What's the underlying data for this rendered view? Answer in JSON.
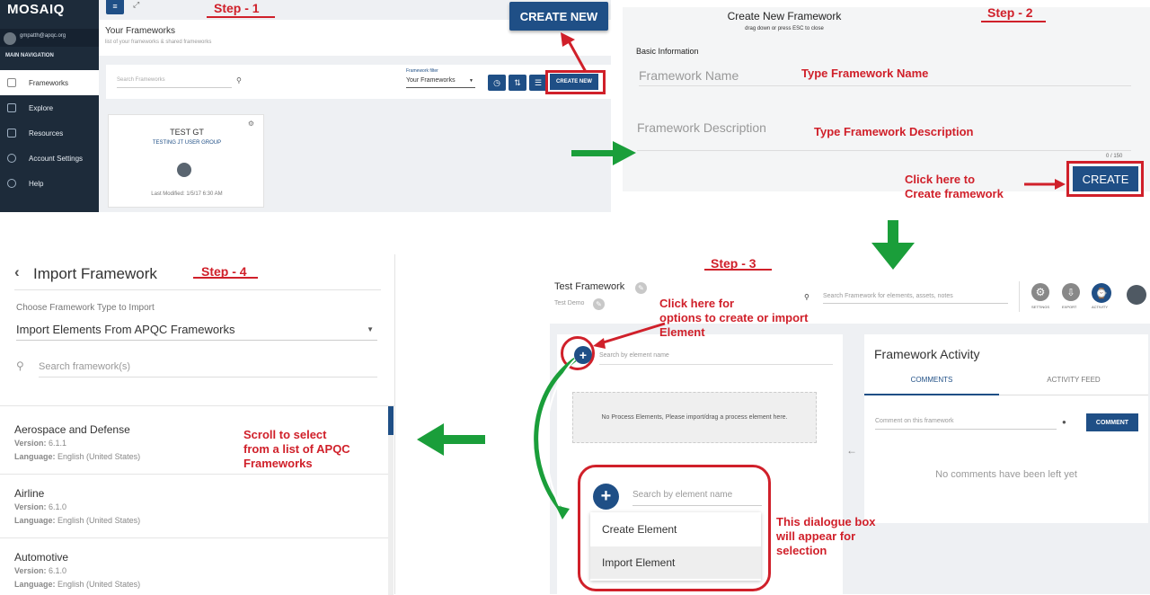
{
  "steps": {
    "step1": "Step - 1",
    "step2": "Step - 2",
    "step3": "Step - 3",
    "step4": "Step - 4"
  },
  "annotations": {
    "type_name": "Type Framework Name",
    "type_desc": "Type Framework Description",
    "click_create_1": "Click here to",
    "click_create_2": "Create framework",
    "click_options_1": "Click here for",
    "click_options_2": "options to create or import",
    "click_options_3": "Element",
    "scroll_1": "Scroll to select",
    "scroll_2": "from a list of APQC",
    "scroll_3": "Frameworks",
    "dialogue_1": "This dialogue box",
    "dialogue_2": "will appear for",
    "dialogue_3": "selection"
  },
  "panel1": {
    "logo": "MOSAIQ",
    "user_email": "gmpatth@apqc.org",
    "main_nav": "MAIN NAVIGATION",
    "nav": [
      {
        "label": "Frameworks"
      },
      {
        "label": "Explore"
      },
      {
        "label": "Resources"
      },
      {
        "label": "Account Settings"
      },
      {
        "label": "Help"
      }
    ],
    "page_title": "Your Frameworks",
    "page_subtitle": "list of your frameworks & shared frameworks",
    "search_placeholder": "Search Frameworks",
    "filter_label": "Framework filter",
    "filter_value": "Your Frameworks",
    "create_new_small": "CREATE NEW",
    "create_new_big": "CREATE NEW",
    "card": {
      "title": "TEST GT",
      "group": "TESTING JT USER GROUP",
      "modified": "Last Modified: 1/5/17 6:30 AM"
    }
  },
  "panel2": {
    "title": "Create New Framework",
    "subtitle": "drag down or press ESC to close",
    "section": "Basic Information",
    "name_placeholder": "Framework Name",
    "desc_placeholder": "Framework Description",
    "counter": "0 / 150",
    "create_button": "CREATE"
  },
  "panel3": {
    "framework_title": "Test Framework",
    "framework_sub": "Test Demo",
    "search_placeholder": "Search Framework for elements, assets, notes",
    "tools": [
      {
        "label": "SETTINGS"
      },
      {
        "label": "EXPORT"
      },
      {
        "label": "ACTIVITY"
      }
    ],
    "element_search": "Search by element name",
    "empty_msg": "No Process Elements, Please import/drag a process element here.",
    "activity_title": "Framework Activity",
    "tab_comments": "COMMENTS",
    "tab_feed": "ACTIVITY FEED",
    "comment_placeholder": "Comment on this framework",
    "comment_button": "COMMENT",
    "no_comments": "No comments have been left yet",
    "dialog": {
      "search": "Search by element name",
      "opt_create": "Create Element",
      "opt_import": "Import Element"
    }
  },
  "panel4": {
    "title": "Import Framework",
    "choose_label": "Choose Framework Type to Import",
    "select_value": "Import Elements From APQC Frameworks",
    "search_placeholder": "Search framework(s)",
    "list": [
      {
        "name": "Aerospace and Defense",
        "version_label": "Version:",
        "version": "6.1.1",
        "lang_label": "Language:",
        "lang": "English (United States)"
      },
      {
        "name": "Airline",
        "version_label": "Version:",
        "version": "6.1.0",
        "lang_label": "Language:",
        "lang": "English (United States)"
      },
      {
        "name": "Automotive",
        "version_label": "Version:",
        "version": "6.1.0",
        "lang_label": "Language:",
        "lang": "English (United States)"
      }
    ]
  },
  "colors": {
    "accent": "#1f4f86",
    "annotation_red": "#d0202a",
    "arrow_green": "#1a9e3a",
    "sidebar": "#1d2b3a"
  }
}
